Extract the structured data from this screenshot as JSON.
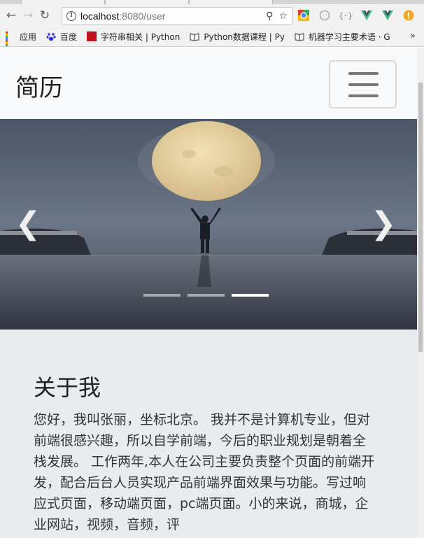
{
  "browser": {
    "url_host": "localhost",
    "url_path": ":8080/user",
    "bookmarks": [
      {
        "label": "应用"
      },
      {
        "label": "百度"
      },
      {
        "label": "字符串相关 | Python"
      },
      {
        "label": "Python数据课程 | Py"
      },
      {
        "label": "机器学习主要术语 · G"
      }
    ],
    "more_bookmarks": "»"
  },
  "navbar": {
    "brand": "简历",
    "toggler_icon": "hamburger-icon"
  },
  "carousel": {
    "slide_count": 3,
    "active_slide": 3,
    "prev_glyph": "❮",
    "next_glyph": "❯"
  },
  "about": {
    "title": "关于我",
    "body": "您好，我叫张丽，坐标北京。 我并不是计算机专业，但对前端很感兴趣，所以自学前端，今后的职业规划是朝着全栈发展。 工作两年,本人在公司主要负责整个页面的前端开发，配合后台人员实现产品前端界面效果与功能。写过响应式页面，移动端页面，pc端页面。小的来说，商城，企业网站，视频，音频，评"
  },
  "colors": {
    "navbar_bg": "#f8f9fa",
    "about_bg": "#e9ecef"
  }
}
